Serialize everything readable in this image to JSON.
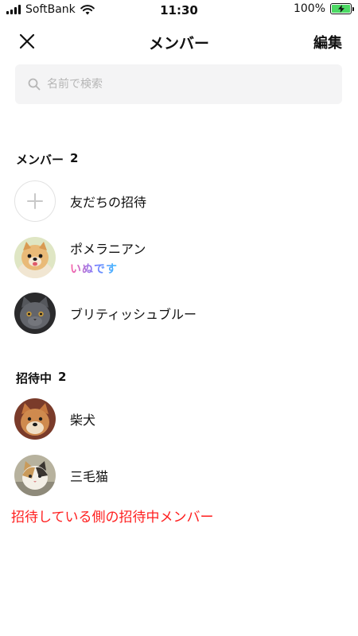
{
  "status_bar": {
    "carrier": "SoftBank",
    "time": "11:30",
    "battery": "100%",
    "battery_level": 1.0,
    "battery_color": "#4cd964",
    "icons": [
      "signal-icon",
      "wifi-icon",
      "battery-charging-icon"
    ]
  },
  "header": {
    "close_icon": "close-icon",
    "title": "メンバー",
    "edit_label": "編集"
  },
  "search": {
    "icon": "search-icon",
    "placeholder": "名前で検索"
  },
  "members_section": {
    "label": "メンバー",
    "count": "2"
  },
  "invite_friends": {
    "icon": "plus-icon",
    "label": "友だちの招待"
  },
  "members": [
    {
      "name": "ポメラニアン",
      "status_message": "いぬです",
      "avatar": "pomeranian-photo"
    },
    {
      "name": "ブリティッシュブルー",
      "avatar": "british-blue-cat-photo"
    }
  ],
  "invited_section": {
    "label": "招待中",
    "count": "2"
  },
  "invited": [
    {
      "name": "柴犬",
      "avatar": "shiba-inu-photo"
    },
    {
      "name": "三毛猫",
      "avatar": "calico-cat-photo"
    }
  ],
  "annotation": {
    "text": "招待している側の招待中メンバー",
    "color": "#ff1e1e"
  }
}
